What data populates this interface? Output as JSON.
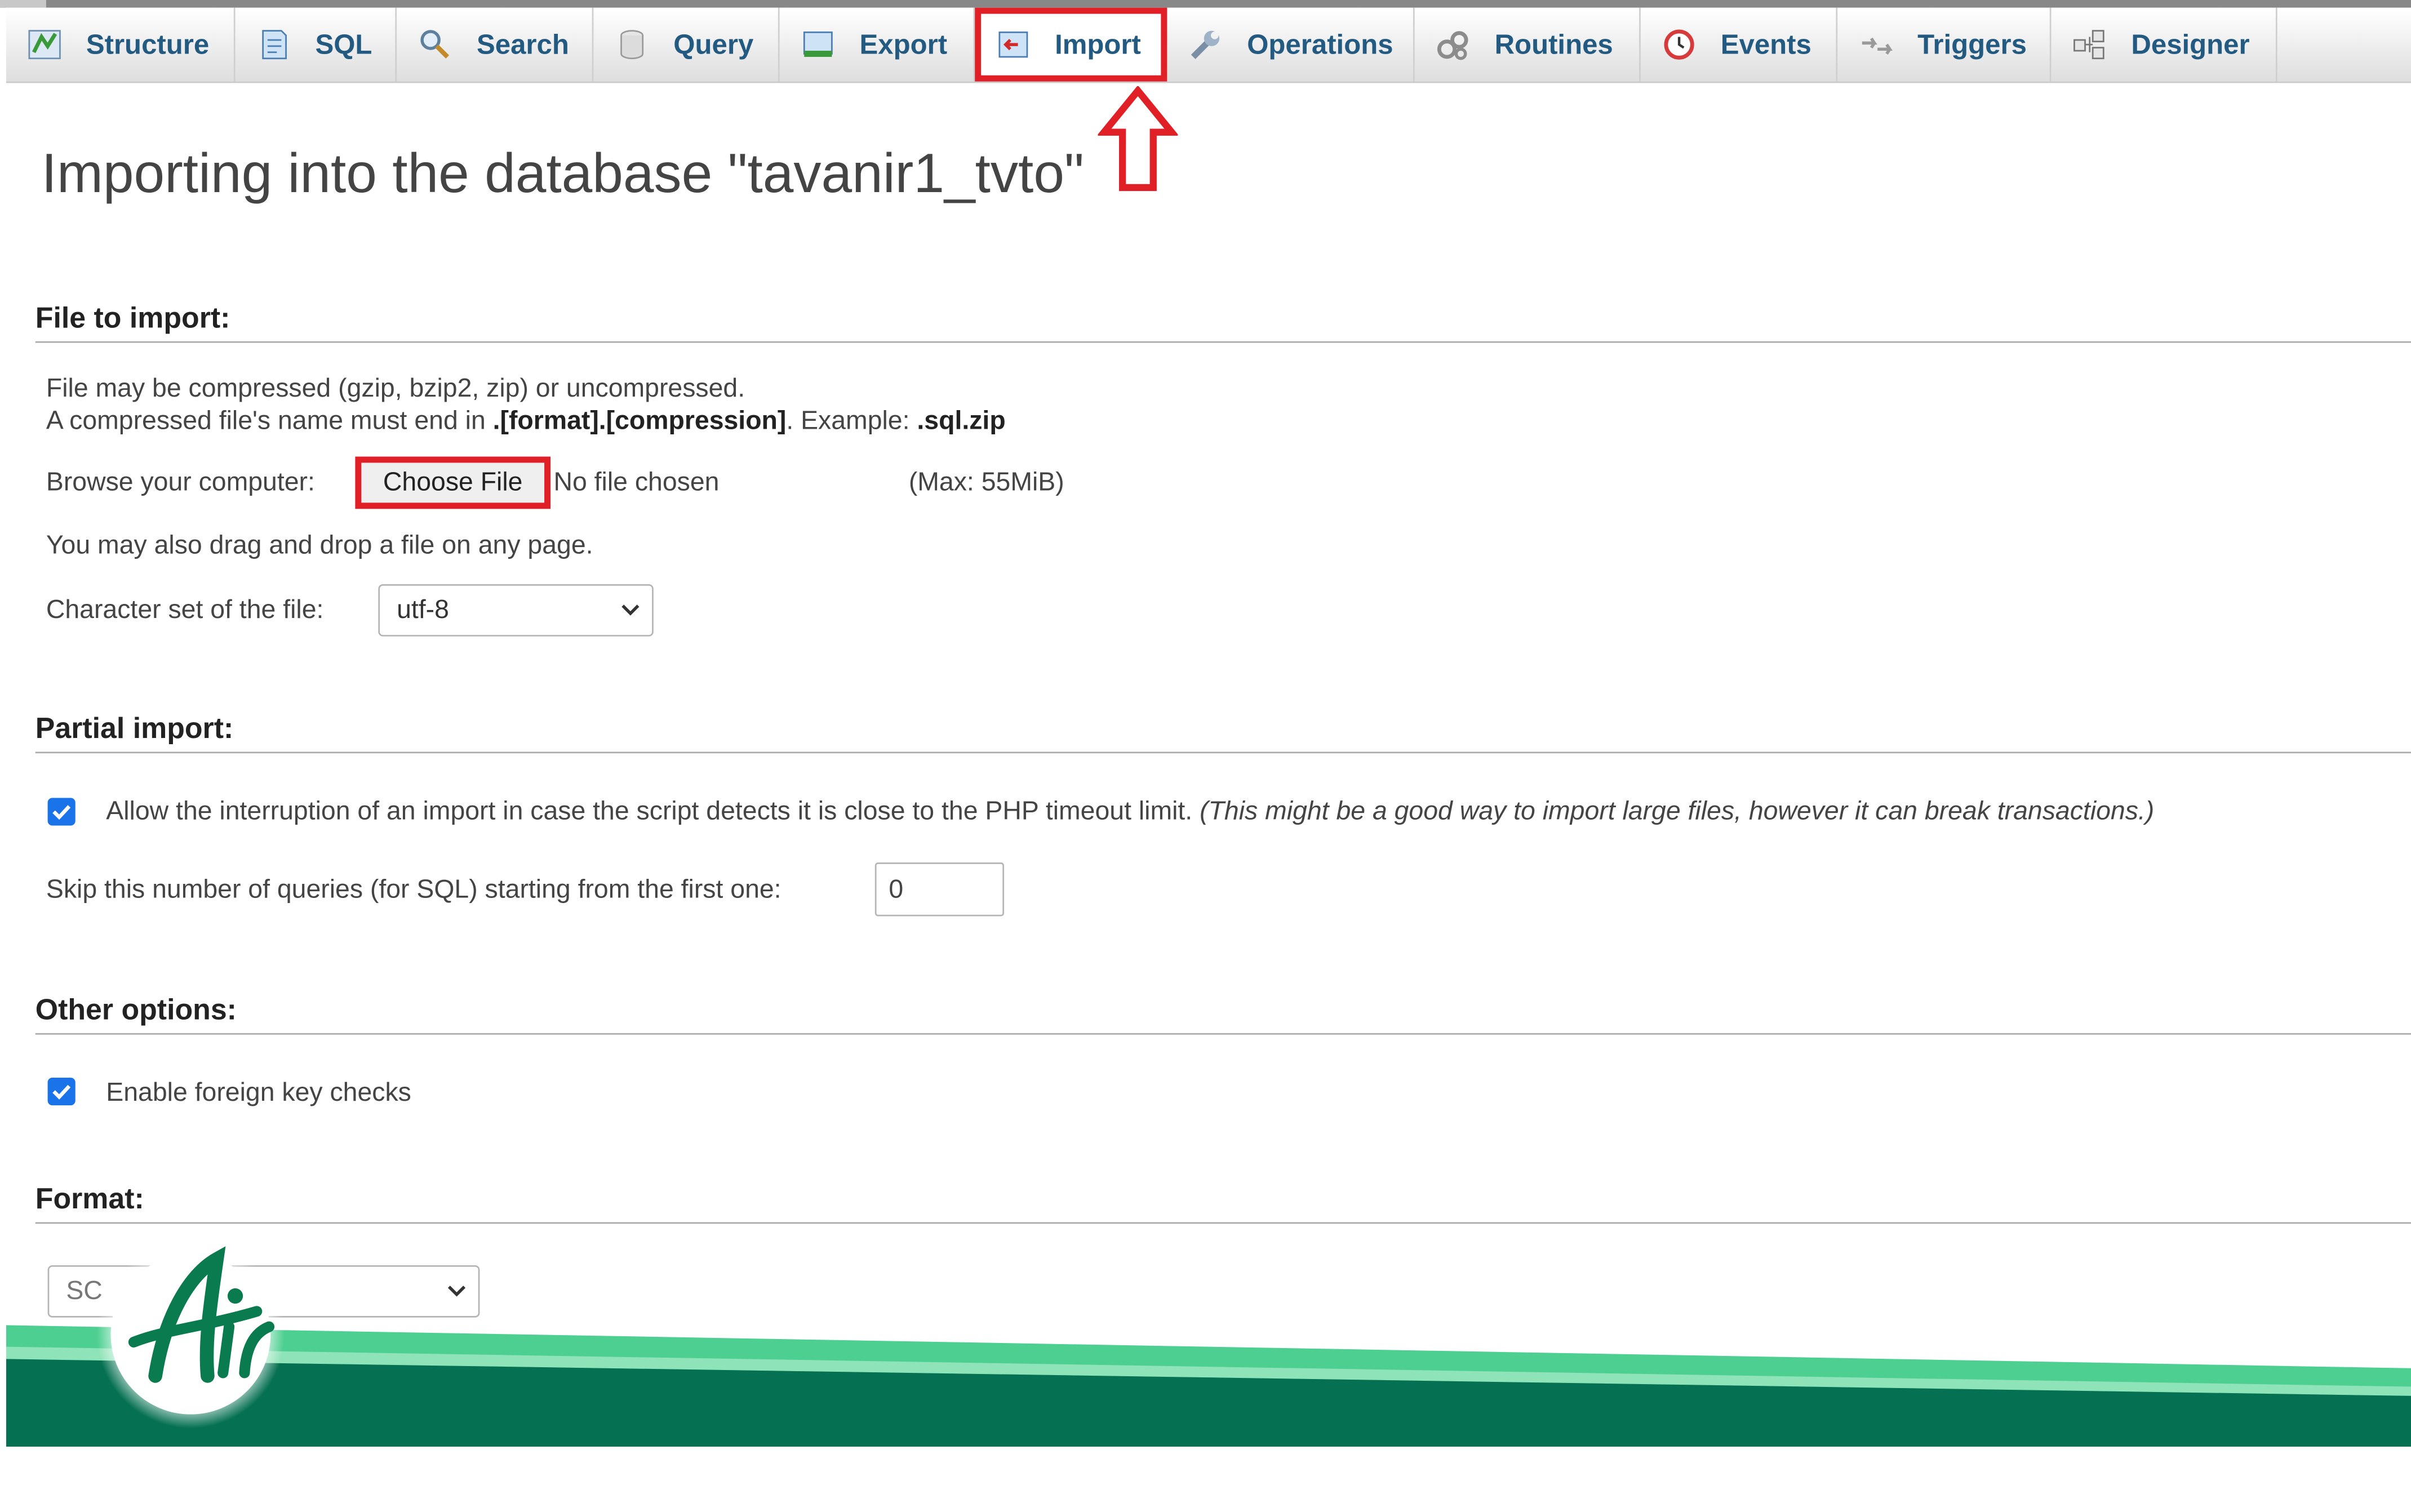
{
  "tabs": [
    {
      "label": "Structure",
      "icon": "structure-icon"
    },
    {
      "label": "SQL",
      "icon": "sql-icon"
    },
    {
      "label": "Search",
      "icon": "search-icon"
    },
    {
      "label": "Query",
      "icon": "query-icon"
    },
    {
      "label": "Export",
      "icon": "export-icon"
    },
    {
      "label": "Import",
      "icon": "import-icon",
      "active": true
    },
    {
      "label": "Operations",
      "icon": "wrench-icon"
    },
    {
      "label": "Routines",
      "icon": "routines-icon"
    },
    {
      "label": "Events",
      "icon": "clock-icon"
    },
    {
      "label": "Triggers",
      "icon": "triggers-icon"
    },
    {
      "label": "Designer",
      "icon": "designer-icon"
    }
  ],
  "page_title": "Importing into the database \"tavanir1_tvto\"",
  "file_section": {
    "heading": "File to import:",
    "line1": "File may be compressed (gzip, bzip2, zip) or uncompressed.",
    "line2_prefix": "A compressed file's name must end in ",
    "line2_bold": ".[format].[compression]",
    "line2_mid": ". Example: ",
    "line2_example": ".sql.zip",
    "browse_label": "Browse your computer:",
    "choose_file_label": "Choose File",
    "no_file_text": "No file chosen",
    "max_size": "(Max: 55MiB)",
    "drag_drop_text": "You may also drag and drop a file on any page.",
    "charset_label": "Character set of the file:",
    "charset_value": "utf-8"
  },
  "partial_section": {
    "heading": "Partial import:",
    "allow_interrupt_checked": true,
    "allow_interrupt_text": "Allow the interruption of an import in case the script detects it is close to the PHP timeout limit.",
    "allow_interrupt_note": "(This might be a good way to import large files, however it can break transactions.)",
    "skip_label": "Skip this number of queries (for SQL) starting from the first one:",
    "skip_value": "0"
  },
  "other_section": {
    "heading": "Other options:",
    "foreign_key_checked": true,
    "foreign_key_text": "Enable foreign key checks"
  },
  "format_section": {
    "heading": "Format:",
    "format_value_visible": "SC"
  },
  "colors": {
    "tab_text": "#235a81",
    "highlight_red": "#e01f26",
    "checkbox_blue": "#1a73e8",
    "banner_light_green": "#4ccf91",
    "banner_dark_green": "#067152"
  }
}
